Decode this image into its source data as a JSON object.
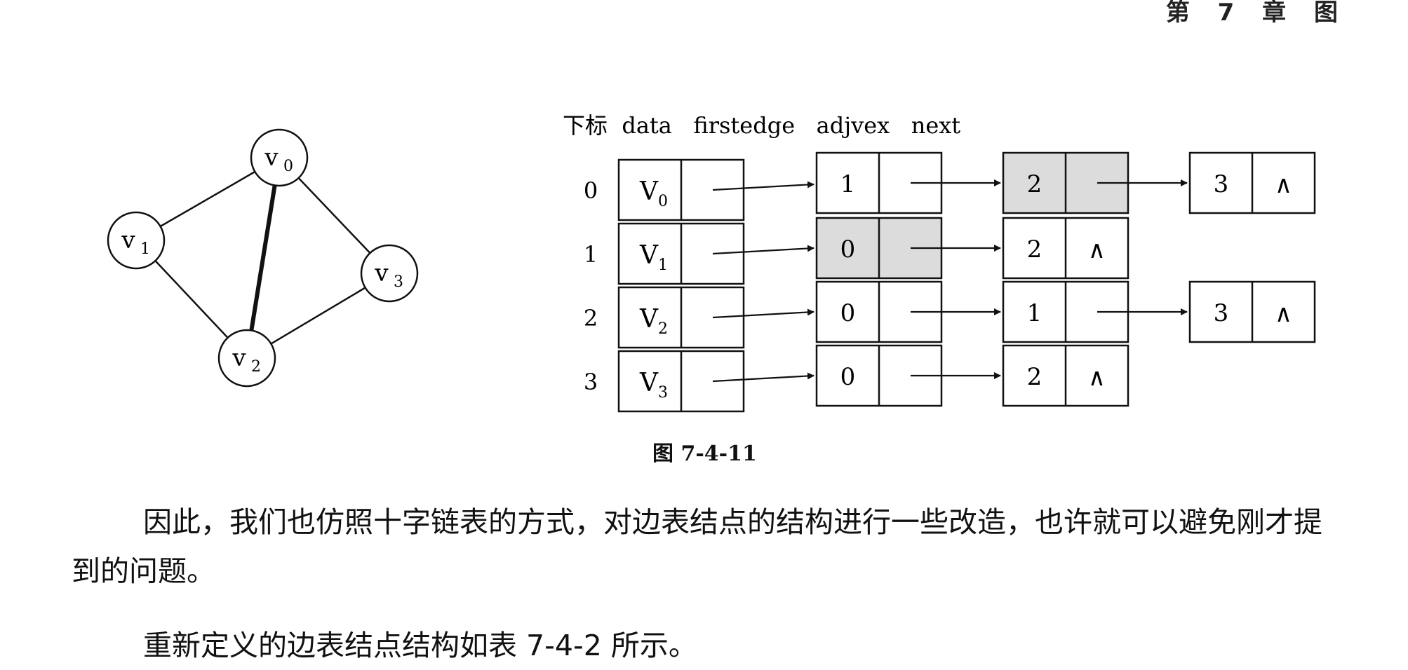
{
  "header": {
    "text": "第 7 章  图"
  },
  "graph": {
    "vertices": [
      {
        "name": "v",
        "sub": "0"
      },
      {
        "name": "v",
        "sub": "1"
      },
      {
        "name": "v",
        "sub": "2"
      },
      {
        "name": "v",
        "sub": "3"
      }
    ]
  },
  "table": {
    "header": "下标  data   firstedge   adjvex   next",
    "rows": [
      {
        "index": "0",
        "data": "V",
        "sub": "0"
      },
      {
        "index": "1",
        "data": "V",
        "sub": "1"
      },
      {
        "index": "2",
        "data": "V",
        "sub": "2"
      },
      {
        "index": "3",
        "data": "V",
        "sub": "3"
      }
    ],
    "edge_lists": [
      [
        {
          "adjvex": "1",
          "shaded": false,
          "last": false
        },
        {
          "adjvex": "2",
          "shaded": true,
          "last": false
        },
        {
          "adjvex": "3",
          "shaded": false,
          "last": true
        }
      ],
      [
        {
          "adjvex": "0",
          "shaded": true,
          "last": false
        },
        {
          "adjvex": "2",
          "shaded": false,
          "last": true
        }
      ],
      [
        {
          "adjvex": "0",
          "shaded": false,
          "last": false
        },
        {
          "adjvex": "1",
          "shaded": false,
          "last": false
        },
        {
          "adjvex": "3",
          "shaded": false,
          "last": true
        }
      ],
      [
        {
          "adjvex": "0",
          "shaded": false,
          "last": false
        },
        {
          "adjvex": "2",
          "shaded": false,
          "last": true
        }
      ]
    ],
    "null_symbol": "∧"
  },
  "caption": "图 7-4-11",
  "paragraph": "因此，我们也仿照十字链表的方式，对边表结点的结构进行一些改造，也许就可以避免刚才提到的问题。",
  "next_paragraph": "重新定义的边表结点结构如表 7-4-2 所示。",
  "colors": {
    "shade": "#dcdcdc",
    "line": "#111111"
  }
}
